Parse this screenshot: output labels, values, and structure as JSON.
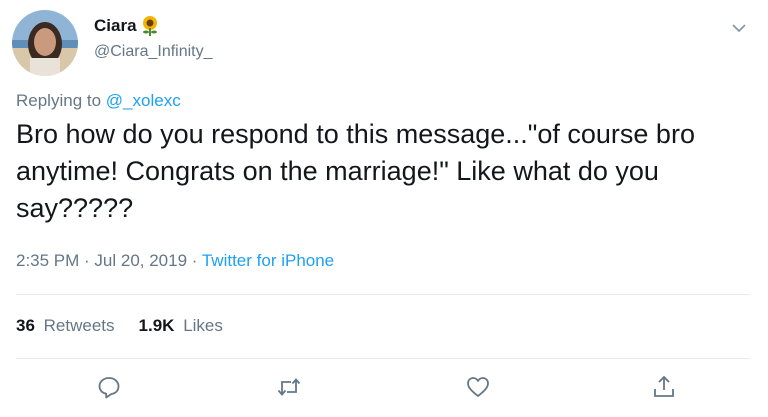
{
  "tweet": {
    "author": {
      "name": "Ciara",
      "emoji": "sunflower",
      "handle": "@Ciara_Infinity_"
    },
    "replying_prefix": "Replying to",
    "replying_to": "@_xolexc",
    "text": "Bro how do you respond to this message...\"of course bro anytime! Congrats on the marriage!\" Like what do you say?????",
    "time": "2:35 PM · Jul 20, 2019 · ",
    "source": "Twitter for iPhone",
    "retweets_count": "36",
    "retweets_label": "Retweets",
    "likes_count": "1.9K",
    "likes_label": "Likes"
  },
  "icons": {
    "caret": "chevron-down-icon",
    "reply": "reply-icon",
    "retweet": "retweet-icon",
    "like": "heart-icon",
    "share": "share-icon"
  },
  "colors": {
    "link": "#1da1f2",
    "secondary_text": "#657786",
    "primary_text": "#14171a",
    "divider": "#e6ecf0"
  }
}
